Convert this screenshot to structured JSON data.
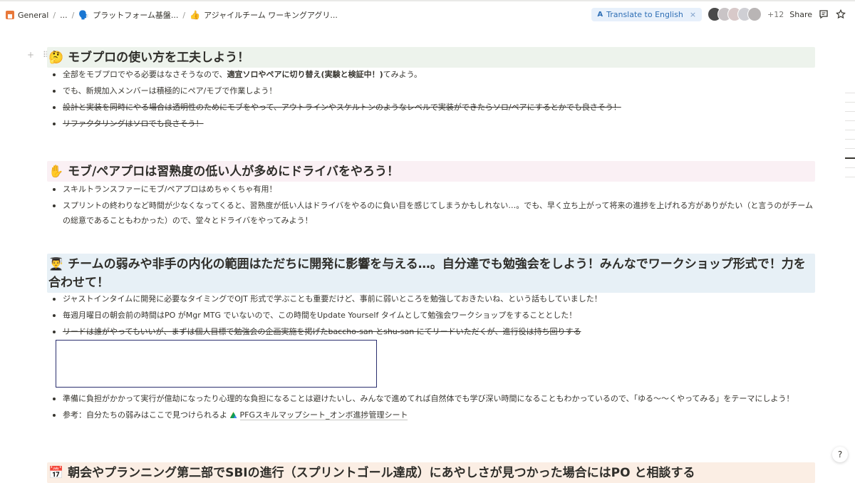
{
  "breadcrumb": {
    "items": [
      {
        "icon": "home-icon",
        "label": "General"
      },
      {
        "label": "..."
      },
      {
        "icon": "speech-bubble-icon",
        "emoji": "🗣️",
        "label": "プラットフォーム基盤..."
      },
      {
        "icon": "thumbs-up-icon",
        "emoji": "👍",
        "label": "アジャイルチーム ワーキングアグリ..."
      }
    ],
    "separator": "/"
  },
  "topbar": {
    "translate_label": "Translate to English",
    "translate_close": "×",
    "avatar_count": "+12",
    "share_label": "Share"
  },
  "sections": [
    {
      "emoji": "🤔",
      "title": "モブプロの使い方を工夫しよう！",
      "bullets": [
        {
          "pre": "全部をモブプロでやる必要はなさそうなので、",
          "bold": "適宜ソロやペアに切り替え(実験と検証中！)",
          "post": "てみよう。"
        },
        {
          "text": "でも、新規加入メンバーは積極的にペア/モブで作業しよう！"
        },
        {
          "text": "設計と実装を同時にやる場合は透明性のためにモブをやって、アウトラインやスケルトンのようなレベルで実装ができたらソロ/ペアにするとかでも良さそう！",
          "strike": true
        },
        {
          "text": "リファクタリングはソロでも良さそう！",
          "strike": true
        }
      ]
    },
    {
      "emoji": "✋",
      "title": "モブ/ペアプロは習熟度の低い人が多めにドライバをやろう！",
      "bullets": [
        {
          "text": "スキルトランスファーにモブ/ペアプロはめちゃくちゃ有用！"
        },
        {
          "text": "スプリントの終わりなど時間が少なくなってくると、習熟度が低い人はドライバをやるのに負い目を感じてしまうかもしれない…。でも、早く立ち上がって将来の進捗を上げれる方がありがたい（と言うのがチームの総意であることもわかった）ので、堂々とドライバをやってみよう！"
        }
      ]
    },
    {
      "emoji": "👨‍🎓",
      "title": "チームの弱みや非手の内化の範囲はただちに開発に影響を与える…。自分達でも勉強会をしよう！みんなでワークショップ形式で！力を合わせて！",
      "bullets": [
        {
          "text": "ジャストインタイムに開発に必要なタイミングでOJT 形式で学ぶことも重要だけど、事前に弱いところを勉強しておきたいね、という話もしていました！"
        },
        {
          "text": "毎週月曜日の朝会前の時間はPO がMgr MTG でいないので、この時間をUpdate Yourself タイムとして勉強会ワークショップをすることとした！"
        },
        {
          "text": "リードは誰がやってもいいが、まずは個人目標で勉強会の企画実施を掲げたbaccho-san とshu-san にてリードいただくが、進行役は持ち回りする",
          "strike": true
        }
      ],
      "bullets_after_embed": [
        {
          "text": "準備に負担がかかって実行が億劫になったり心理的な負担になることは避けたいし、みんなで進めてれば自然体でも学び深い時間になることもわかっているので、「ゆる〜〜くやってみる」をテーマにしよう！"
        },
        {
          "pre": "参考：自分たちの弱みはここで見つけられるよ ",
          "link": "PFGスキルマップシート_オンボ進捗管理シート"
        }
      ]
    },
    {
      "emoji": "📅",
      "title": "朝会やプランニング第二部でSBIの進行（スプリントゴール達成）にあやしさが見つかった場合にはPO と相談する"
    }
  ],
  "colors": {
    "heading_green": "#edf3ec",
    "heading_pink": "#faf0f4",
    "heading_blue": "#e7f0f6",
    "heading_orange": "#fbeee4",
    "translate_bg": "#e7f0fb",
    "translate_text": "#2f6fb5"
  }
}
